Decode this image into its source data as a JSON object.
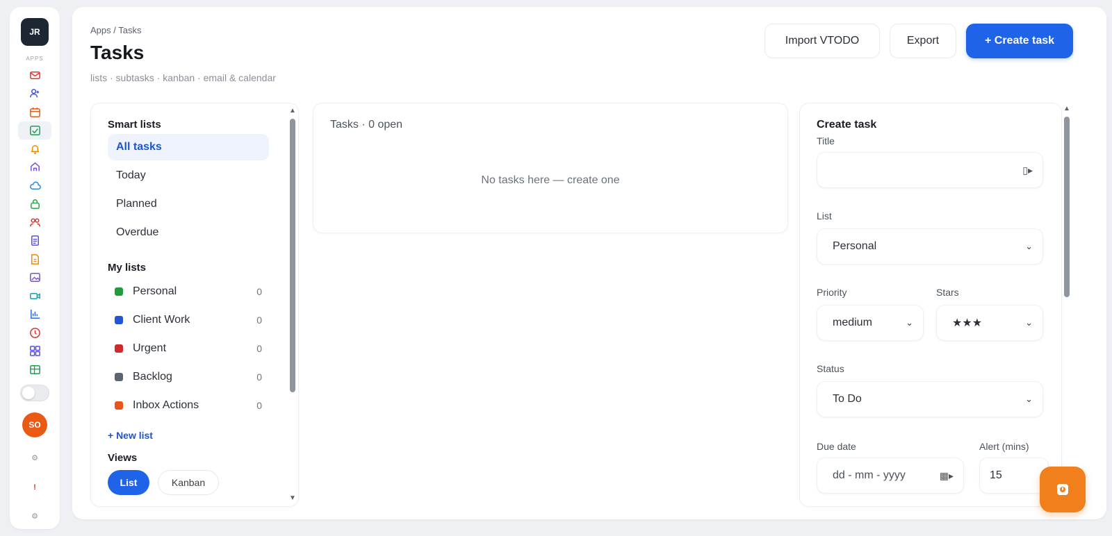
{
  "rail": {
    "logo": "JR",
    "caption": "APPS",
    "icons": [
      {
        "name": "mail-icon",
        "color": "#e0332d"
      },
      {
        "name": "contacts-icon",
        "color": "#4a57d6"
      },
      {
        "name": "calendar-icon",
        "color": "#ea5a14"
      },
      {
        "name": "tasks-icon",
        "color": "#1f9d55"
      },
      {
        "name": "bell-icon",
        "color": "#f08c00"
      },
      {
        "name": "home-icon",
        "color": "#7a4fe0"
      },
      {
        "name": "cloud-icon",
        "color": "#2b8be0"
      },
      {
        "name": "lock-icon",
        "color": "#2fa44a"
      },
      {
        "name": "people-icon",
        "color": "#e0332d"
      },
      {
        "name": "document-icon",
        "color": "#5a4fe0"
      },
      {
        "name": "file-icon",
        "color": "#f08c00"
      },
      {
        "name": "image-icon",
        "color": "#7a4fe0"
      },
      {
        "name": "video-icon",
        "color": "#19a0b4"
      },
      {
        "name": "chart-icon",
        "color": "#2b6be0"
      },
      {
        "name": "clock-icon",
        "color": "#e0332d"
      },
      {
        "name": "grid-icon",
        "color": "#5a4fe0"
      },
      {
        "name": "table-icon",
        "color": "#1f9d55"
      }
    ],
    "avatar": "SO",
    "settings_glyph": "⚙",
    "alert_glyph": "!",
    "more_glyph": "⚙"
  },
  "header": {
    "breadcrumb": "Apps / Tasks",
    "title": "Tasks",
    "subtitle": "lists · subtasks · kanban · email & calendar",
    "import_label": "Import VTODO",
    "export_label": "Export",
    "create_label": "+ Create task"
  },
  "lists_panel": {
    "smart_title": "Smart lists",
    "smart_items": [
      "All tasks",
      "Today",
      "Planned",
      "Overdue"
    ],
    "my_title": "My lists",
    "my_lists": [
      {
        "label": "Personal",
        "count": "0",
        "color": "#1f9d3a"
      },
      {
        "label": "Client Work",
        "count": "0",
        "color": "#1f55d6"
      },
      {
        "label": "Urgent",
        "count": "0",
        "color": "#d12a2a"
      },
      {
        "label": "Backlog",
        "count": "0",
        "color": "#5b6470"
      },
      {
        "label": "Inbox Actions",
        "count": "0",
        "color": "#e8561a"
      }
    ],
    "new_list": "+ New list",
    "views_title": "Views",
    "view_list": "List",
    "view_kanban": "Kanban"
  },
  "tasks_panel": {
    "header": "Tasks · 0 open",
    "empty": "No tasks here — create one"
  },
  "create_form": {
    "title": "Create task",
    "title_label": "Title",
    "title_value": "",
    "list_label": "List",
    "list_value": "Personal",
    "priority_label": "Priority",
    "priority_value": "medium",
    "stars_label": "Stars",
    "stars_value": "★★★",
    "status_label": "Status",
    "status_value": "To Do",
    "due_label": "Due date",
    "due_placeholder": "dd - mm - yyyy",
    "alert_label": "Alert (mins)",
    "alert_value": "15"
  },
  "colors": {
    "accent": "#1f63e8",
    "fab": "#f07f1c"
  }
}
